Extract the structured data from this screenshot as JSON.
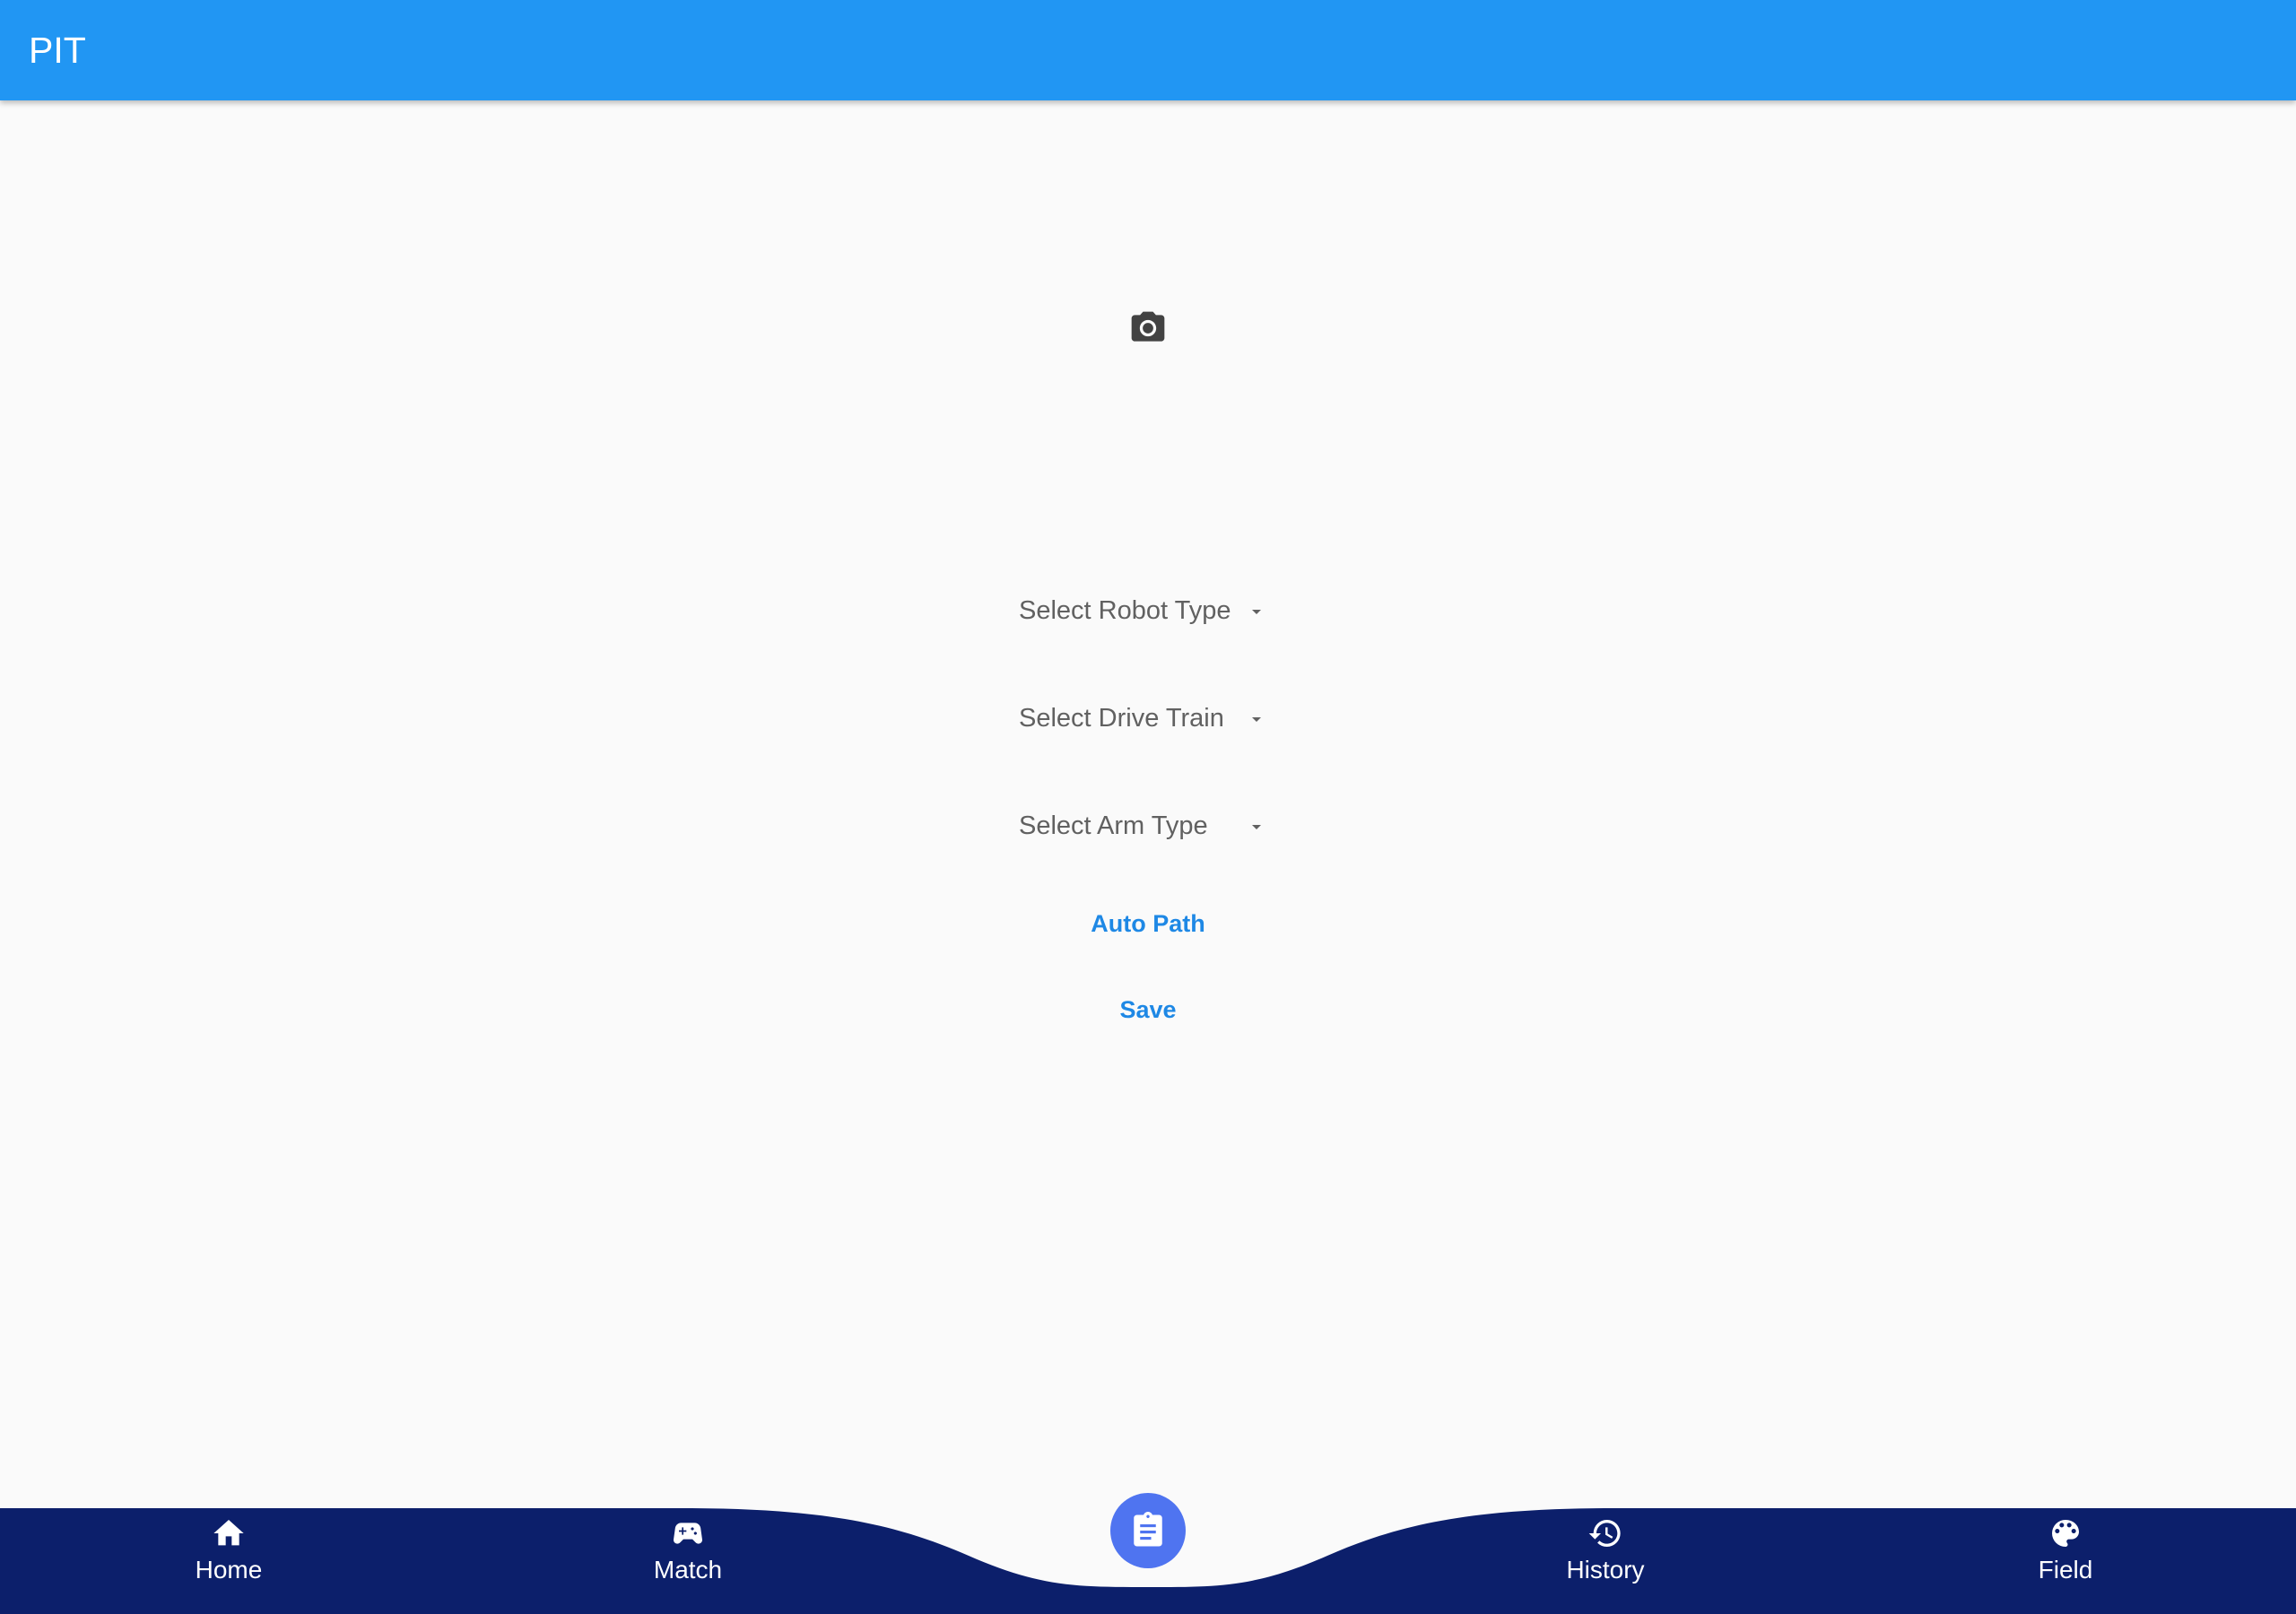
{
  "app_bar": {
    "title": "PIT",
    "color": "#2196f3"
  },
  "main": {
    "camera_icon": "camera-icon",
    "dropdowns": [
      {
        "placeholder": "Select Robot Type"
      },
      {
        "placeholder": "Select Drive Train"
      },
      {
        "placeholder": "Select Arm Type"
      }
    ],
    "buttons": {
      "auto_path": "Auto Path",
      "save": "Save"
    },
    "accent_color": "#1e88e5"
  },
  "bottom_nav": {
    "background_color": "#0c1f6b",
    "active_color": "#4f74f0",
    "items": [
      {
        "label": "Home",
        "icon": "home-icon"
      },
      {
        "label": "Match",
        "icon": "gamepad-icon"
      },
      {
        "label": "",
        "icon": "clipboard-icon",
        "active": true
      },
      {
        "label": "History",
        "icon": "history-icon"
      },
      {
        "label": "Field",
        "icon": "palette-icon"
      }
    ]
  }
}
